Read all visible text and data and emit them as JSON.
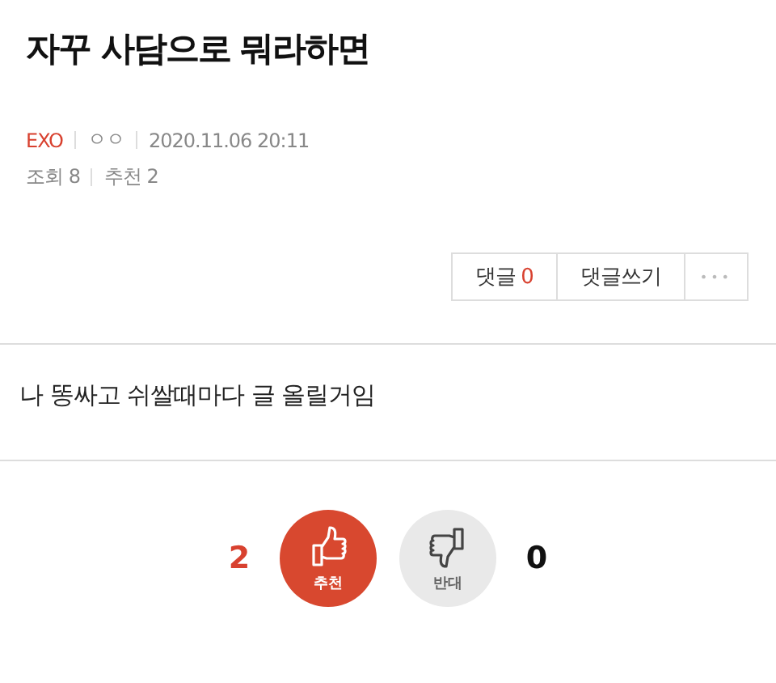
{
  "post": {
    "title": "자꾸 사담으로 뭐라하면",
    "board": "EXO",
    "author": "ㅇㅇ",
    "date": "2020.11.06 20:11",
    "views": "조회 8",
    "recommends": "추천 2"
  },
  "actions": {
    "comments_label": "댓글",
    "comments_count": "0",
    "write": "댓글쓰기",
    "more": "•••"
  },
  "body": "나 똥싸고 쉬쌀때마다 글 올릴거임",
  "votes": [
    {
      "kind": "up",
      "count": "2",
      "label": "추천"
    },
    {
      "kind": "down",
      "count": "0",
      "label": "반대"
    }
  ]
}
